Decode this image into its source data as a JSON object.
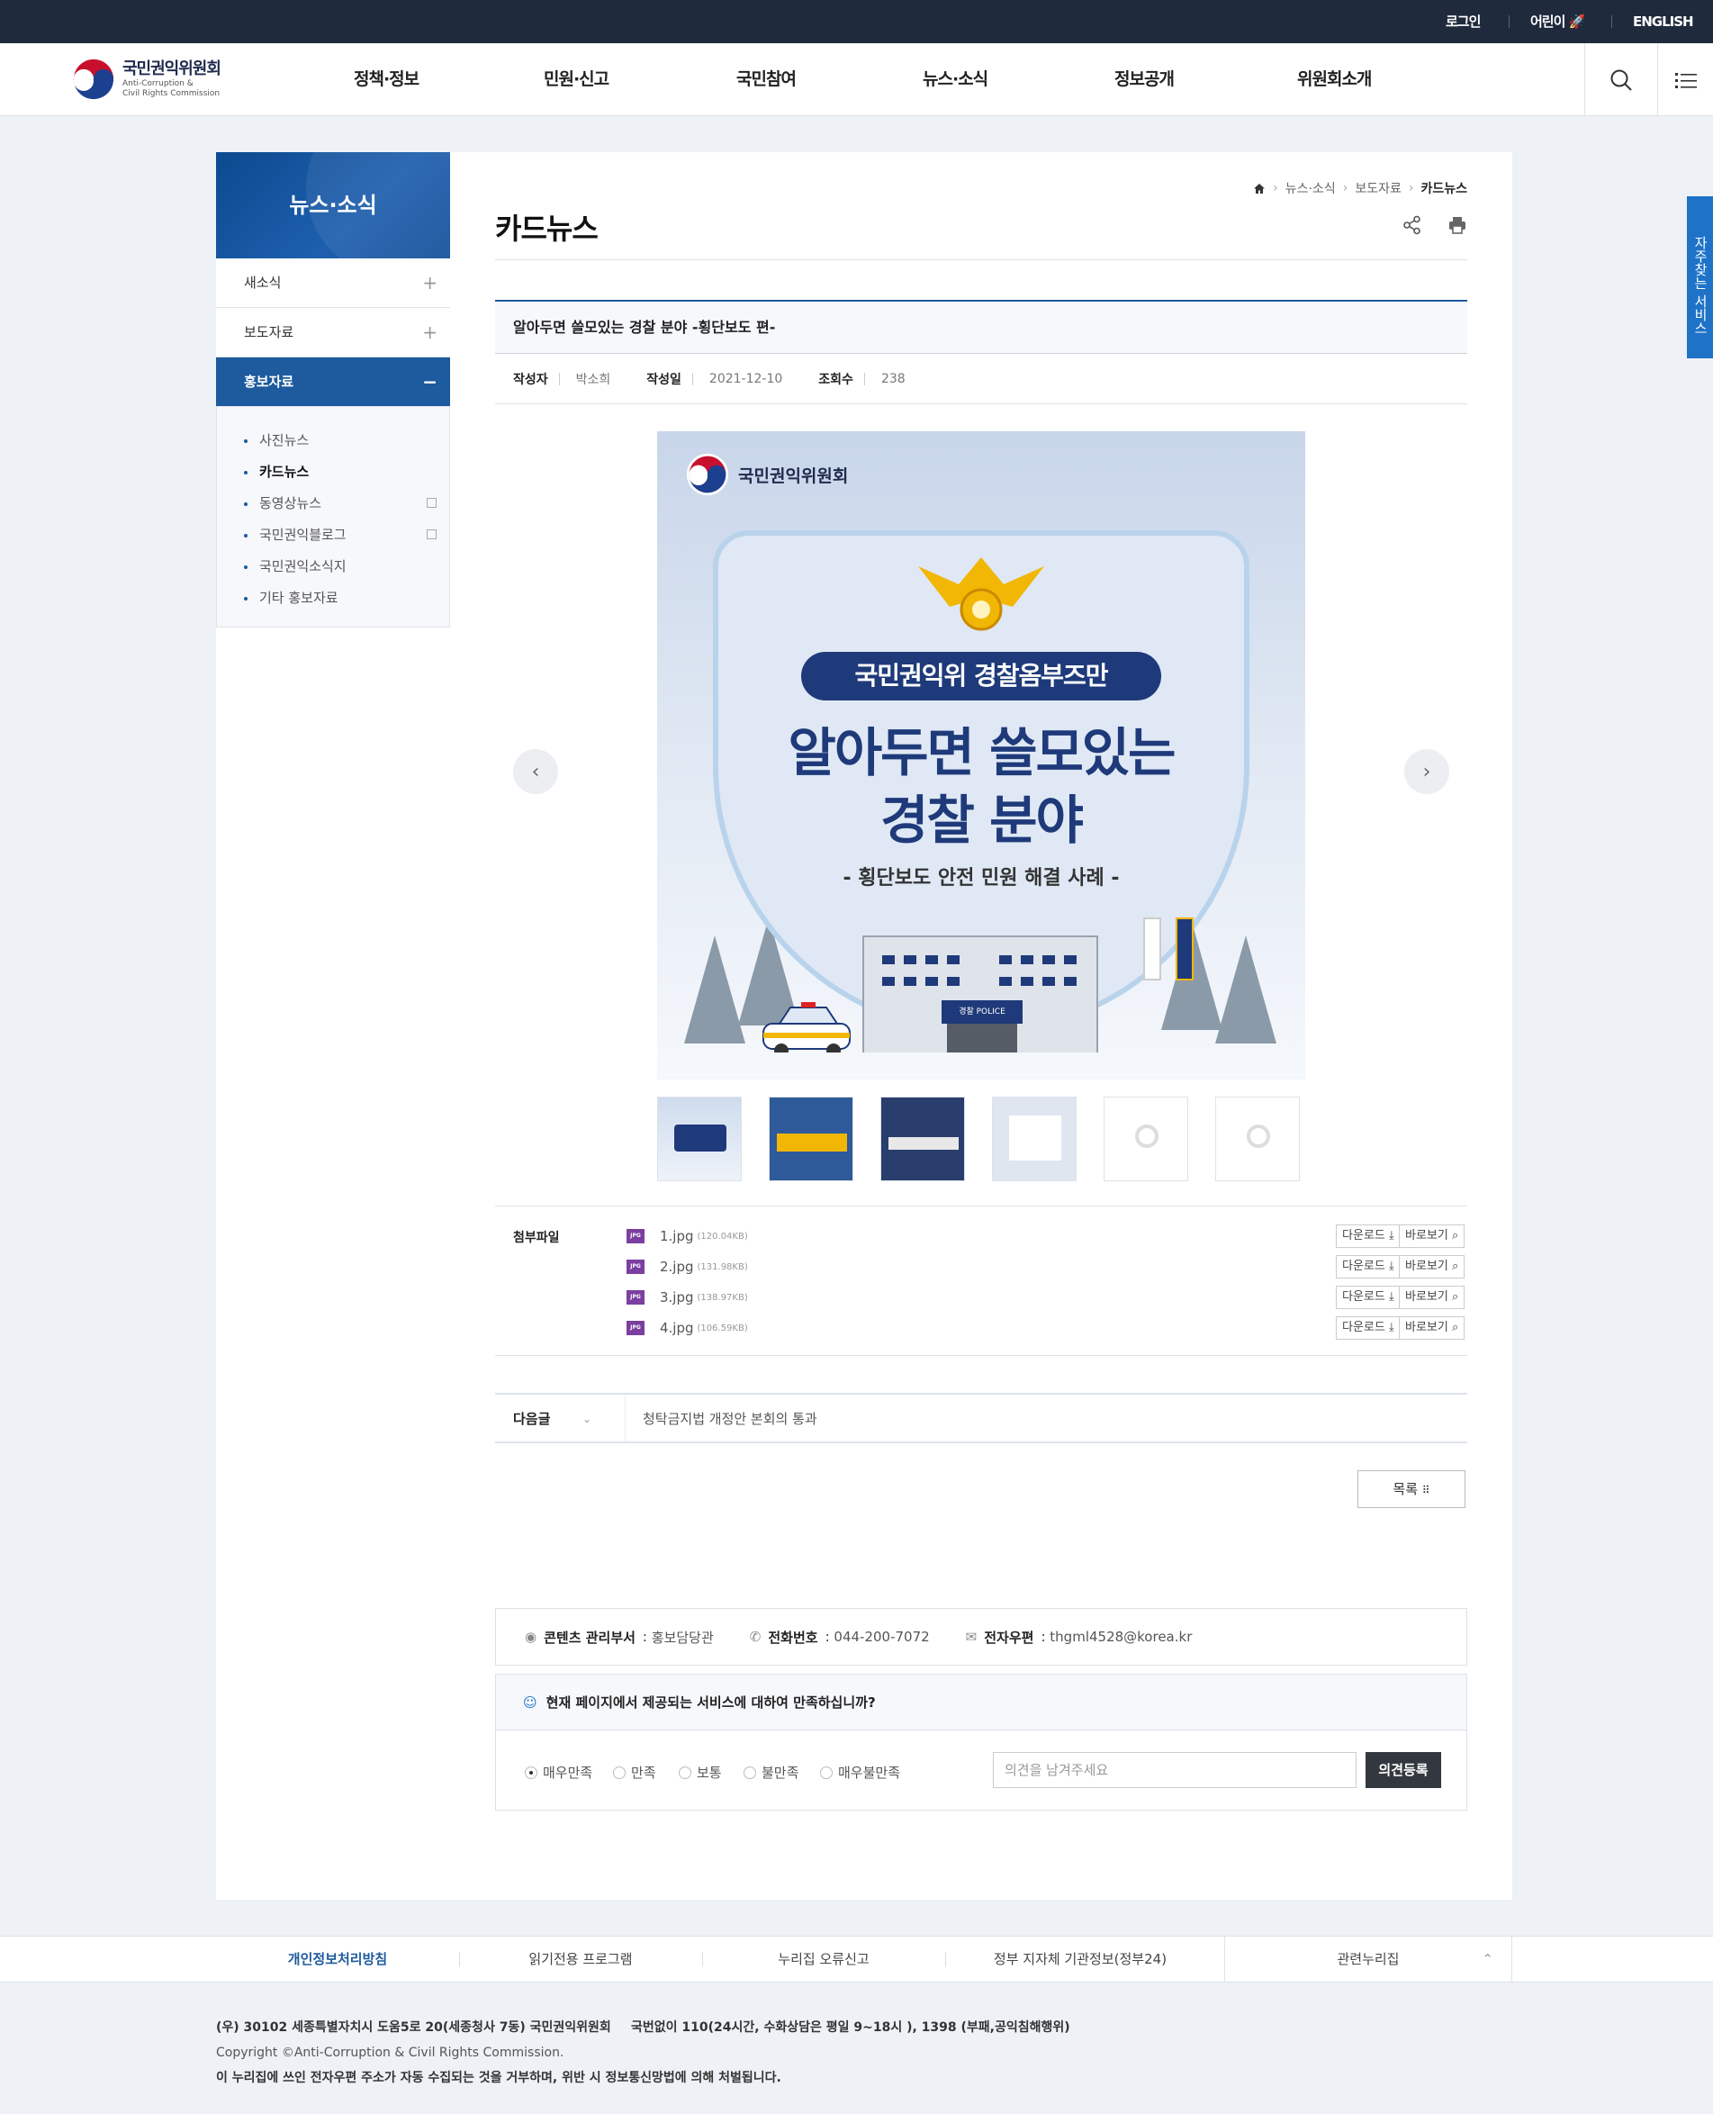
{
  "topbar": {
    "login": "로그인",
    "kids": "어린이",
    "english": "ENGLISH"
  },
  "header": {
    "logo_ko": "국민권익위원회",
    "logo_en1": "Anti-Corruption &",
    "logo_en2": "Civil Rights Commission",
    "menus": [
      "정책·정보",
      "민원·신고",
      "국민참여",
      "뉴스·소식",
      "정보공개",
      "위원회소개"
    ]
  },
  "lnb": {
    "title": "뉴스·소식",
    "items": [
      "새소식",
      "보도자료",
      "홍보자료"
    ],
    "sub": [
      "사진뉴스",
      "카드뉴스",
      "동영상뉴스",
      "국민권익블로그",
      "국민권익소식지",
      "기타 홍보자료"
    ]
  },
  "breadcrumb": [
    "뉴스·소식",
    "보도자료",
    "카드뉴스"
  ],
  "page_title": "카드뉴스",
  "post": {
    "title": "알아두면 쓸모있는 경찰 분야 -횡단보도 편-",
    "author_label": "작성자",
    "author": "박소희",
    "date_label": "작성일",
    "date": "2021-12-10",
    "views_label": "조회수",
    "views": "238"
  },
  "card": {
    "org": "국민권익위원회",
    "pill": "국민권익위 경찰옴부즈만",
    "line1": "알아두면 쓸모있는",
    "line2": "경찰 분야",
    "sub": "- 횡단보도 안전 민원 해결 사례 -",
    "building_sign": "경찰 POLICE"
  },
  "attachments": {
    "label": "첨부파일",
    "download": "다운로드",
    "preview": "바로보기",
    "type": "JPG",
    "files": [
      {
        "name": "1.jpg",
        "size": "(120.04KB)"
      },
      {
        "name": "2.jpg",
        "size": "(131.98KB)"
      },
      {
        "name": "3.jpg",
        "size": "(138.97KB)"
      },
      {
        "name": "4.jpg",
        "size": "(106.59KB)"
      }
    ]
  },
  "next_post": {
    "label": "다음글",
    "title": "청탁금지법 개정안 본회의 통과"
  },
  "list_button": "목록",
  "manager": {
    "dept_label": "콘텐츠 관리부서",
    "dept": "홍보담당관",
    "phone_label": "전화번호",
    "phone": "044-200-7072",
    "email_label": "전자우편",
    "email": "thgml4528@korea.kr"
  },
  "satisfaction": {
    "question": "현재 페이지에서 제공되는 서비스에 대하여 만족하십니까?",
    "options": [
      "매우만족",
      "만족",
      "보통",
      "불만족",
      "매우불만족"
    ],
    "selected": "매우만족",
    "placeholder": "의견을 남겨주세요",
    "submit": "의견등록"
  },
  "side_tab": "자주찾는 서비스",
  "footer_nav": [
    "개인정보처리방침",
    "읽기전용 프로그램",
    "누리집 오류신고",
    "정부 지자체 기관정보(정부24)",
    "관련누리집"
  ],
  "footer": {
    "address": "(우) 30102 세종특별자치시 도움5로 20(세종청사 7동) 국민권익위원회",
    "callcenter": "국번없이 110(24시간, 수화상담은 평일 9~18시 ), 1398 (부패,공익침해행위)",
    "copyright": "Copyright ©Anti-Corruption & Civil Rights Commission.",
    "notice": "이 누리집에 쓰인 전자우편 주소가 자동 수집되는 것을 거부하며, 위반 시 정보통신망법에 의해 처벌됩니다."
  },
  "colors": {
    "topbar": "#1f2a3d",
    "accent": "#1d5a9e",
    "side_tab": "#1e73c8"
  }
}
